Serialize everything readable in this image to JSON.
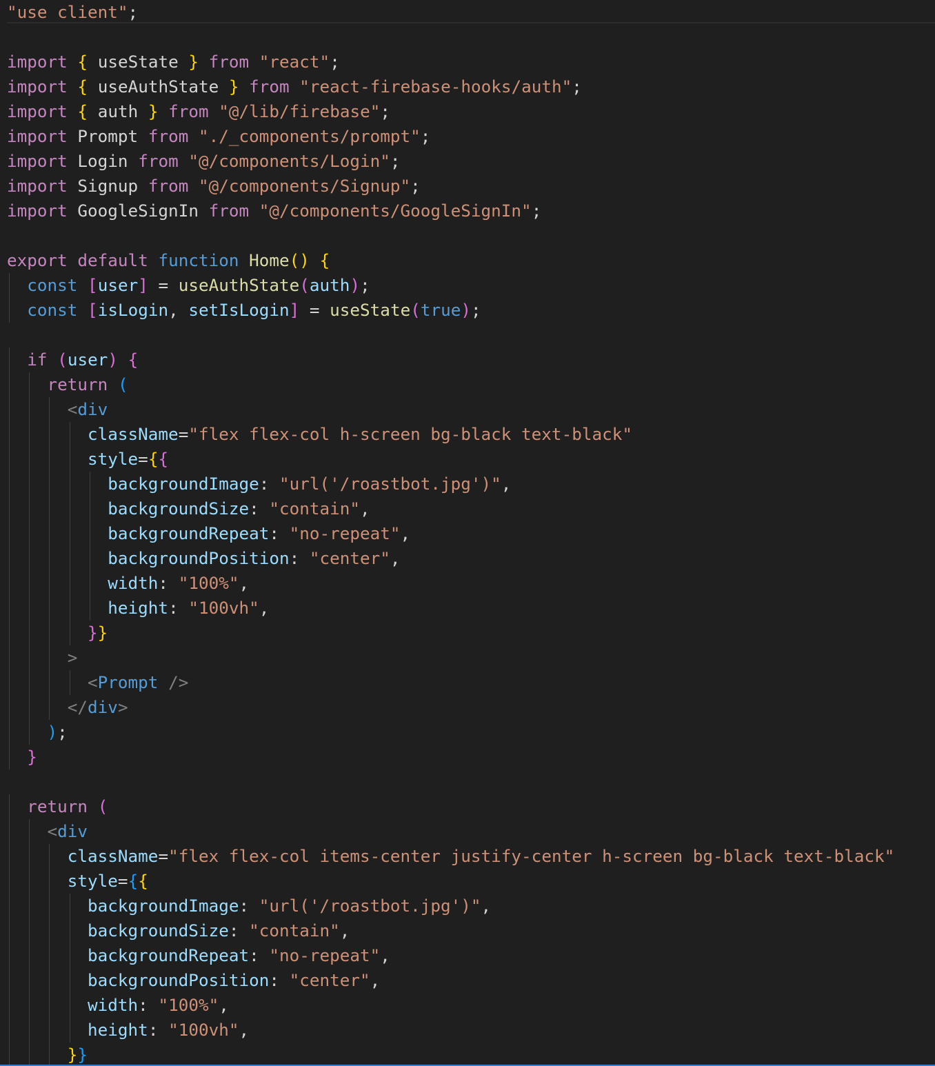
{
  "editor": {
    "language": "typescriptreact",
    "lines": [
      {
        "tokens": [
          [
            "\"use client\"",
            "string"
          ],
          [
            ";",
            "punct"
          ]
        ]
      },
      {
        "tokens": []
      },
      {
        "tokens": [
          [
            "import",
            "control"
          ],
          [
            " ",
            "plain"
          ],
          [
            "{",
            "bracket1"
          ],
          [
            " useState ",
            "plain"
          ],
          [
            "}",
            "bracket1"
          ],
          [
            " ",
            "plain"
          ],
          [
            "from",
            "control"
          ],
          [
            " ",
            "plain"
          ],
          [
            "\"react\"",
            "string"
          ],
          [
            ";",
            "punct"
          ]
        ]
      },
      {
        "tokens": [
          [
            "import",
            "control"
          ],
          [
            " ",
            "plain"
          ],
          [
            "{",
            "bracket1"
          ],
          [
            " useAuthState ",
            "plain"
          ],
          [
            "}",
            "bracket1"
          ],
          [
            " ",
            "plain"
          ],
          [
            "from",
            "control"
          ],
          [
            " ",
            "plain"
          ],
          [
            "\"react-firebase-hooks/auth\"",
            "string"
          ],
          [
            ";",
            "punct"
          ]
        ]
      },
      {
        "tokens": [
          [
            "import",
            "control"
          ],
          [
            " ",
            "plain"
          ],
          [
            "{",
            "bracket1"
          ],
          [
            " auth ",
            "plain"
          ],
          [
            "}",
            "bracket1"
          ],
          [
            " ",
            "plain"
          ],
          [
            "from",
            "control"
          ],
          [
            " ",
            "plain"
          ],
          [
            "\"@/lib/firebase\"",
            "string"
          ],
          [
            ";",
            "punct"
          ]
        ]
      },
      {
        "tokens": [
          [
            "import",
            "control"
          ],
          [
            " Prompt ",
            "plain"
          ],
          [
            "from",
            "control"
          ],
          [
            " ",
            "plain"
          ],
          [
            "\"./_components/prompt\"",
            "string"
          ],
          [
            ";",
            "punct"
          ]
        ]
      },
      {
        "tokens": [
          [
            "import",
            "control"
          ],
          [
            " Login ",
            "plain"
          ],
          [
            "from",
            "control"
          ],
          [
            " ",
            "plain"
          ],
          [
            "\"@/components/Login\"",
            "string"
          ],
          [
            ";",
            "punct"
          ]
        ]
      },
      {
        "tokens": [
          [
            "import",
            "control"
          ],
          [
            " Signup ",
            "plain"
          ],
          [
            "from",
            "control"
          ],
          [
            " ",
            "plain"
          ],
          [
            "\"@/components/Signup\"",
            "string"
          ],
          [
            ";",
            "punct"
          ]
        ]
      },
      {
        "tokens": [
          [
            "import",
            "control"
          ],
          [
            " GoogleSignIn ",
            "plain"
          ],
          [
            "from",
            "control"
          ],
          [
            " ",
            "plain"
          ],
          [
            "\"@/components/GoogleSignIn\"",
            "string"
          ],
          [
            ";",
            "punct"
          ]
        ]
      },
      {
        "tokens": []
      },
      {
        "tokens": [
          [
            "export",
            "control"
          ],
          [
            " ",
            "plain"
          ],
          [
            "default",
            "control"
          ],
          [
            " ",
            "plain"
          ],
          [
            "function",
            "keyword"
          ],
          [
            " ",
            "plain"
          ],
          [
            "Home",
            "func"
          ],
          [
            "()",
            "bracket1"
          ],
          [
            " ",
            "plain"
          ],
          [
            "{",
            "bracket1"
          ]
        ]
      },
      {
        "tokens": [
          [
            "  ",
            "plain"
          ],
          [
            "const",
            "keyword"
          ],
          [
            " ",
            "plain"
          ],
          [
            "[",
            "bracket2"
          ],
          [
            "user",
            "var"
          ],
          [
            "]",
            "bracket2"
          ],
          [
            " = ",
            "plain"
          ],
          [
            "useAuthState",
            "func"
          ],
          [
            "(",
            "bracket2"
          ],
          [
            "auth",
            "var"
          ],
          [
            ")",
            "bracket2"
          ],
          [
            ";",
            "punct"
          ]
        ]
      },
      {
        "tokens": [
          [
            "  ",
            "plain"
          ],
          [
            "const",
            "keyword"
          ],
          [
            " ",
            "plain"
          ],
          [
            "[",
            "bracket2"
          ],
          [
            "isLogin",
            "var"
          ],
          [
            ", ",
            "plain"
          ],
          [
            "setIsLogin",
            "var"
          ],
          [
            "]",
            "bracket2"
          ],
          [
            " = ",
            "plain"
          ],
          [
            "useState",
            "func"
          ],
          [
            "(",
            "bracket2"
          ],
          [
            "true",
            "keyword"
          ],
          [
            ")",
            "bracket2"
          ],
          [
            ";",
            "punct"
          ]
        ]
      },
      {
        "tokens": []
      },
      {
        "tokens": [
          [
            "  ",
            "plain"
          ],
          [
            "if",
            "control"
          ],
          [
            " ",
            "plain"
          ],
          [
            "(",
            "bracket2"
          ],
          [
            "user",
            "var"
          ],
          [
            ")",
            "bracket2"
          ],
          [
            " ",
            "plain"
          ],
          [
            "{",
            "bracket2"
          ]
        ]
      },
      {
        "tokens": [
          [
            "    ",
            "plain"
          ],
          [
            "return",
            "control"
          ],
          [
            " ",
            "plain"
          ],
          [
            "(",
            "bracket3"
          ]
        ]
      },
      {
        "tokens": [
          [
            "      ",
            "plain"
          ],
          [
            "<",
            "tagpunct"
          ],
          [
            "div",
            "tag"
          ]
        ]
      },
      {
        "tokens": [
          [
            "        ",
            "plain"
          ],
          [
            "className",
            "var"
          ],
          [
            "=",
            "punct"
          ],
          [
            "\"flex flex-col h-screen bg-black text-black\"",
            "string"
          ]
        ]
      },
      {
        "tokens": [
          [
            "        ",
            "plain"
          ],
          [
            "style",
            "var"
          ],
          [
            "=",
            "punct"
          ],
          [
            "{",
            "bracket1"
          ],
          [
            "{",
            "bracket2"
          ]
        ]
      },
      {
        "tokens": [
          [
            "          ",
            "plain"
          ],
          [
            "backgroundImage",
            "var"
          ],
          [
            ": ",
            "plain"
          ],
          [
            "\"url('/roastbot.jpg')\"",
            "string"
          ],
          [
            ",",
            "punct"
          ]
        ]
      },
      {
        "tokens": [
          [
            "          ",
            "plain"
          ],
          [
            "backgroundSize",
            "var"
          ],
          [
            ": ",
            "plain"
          ],
          [
            "\"contain\"",
            "string"
          ],
          [
            ",",
            "punct"
          ]
        ]
      },
      {
        "tokens": [
          [
            "          ",
            "plain"
          ],
          [
            "backgroundRepeat",
            "var"
          ],
          [
            ": ",
            "plain"
          ],
          [
            "\"no-repeat\"",
            "string"
          ],
          [
            ",",
            "punct"
          ]
        ]
      },
      {
        "tokens": [
          [
            "          ",
            "plain"
          ],
          [
            "backgroundPosition",
            "var"
          ],
          [
            ": ",
            "plain"
          ],
          [
            "\"center\"",
            "string"
          ],
          [
            ",",
            "punct"
          ]
        ]
      },
      {
        "tokens": [
          [
            "          ",
            "plain"
          ],
          [
            "width",
            "var"
          ],
          [
            ": ",
            "plain"
          ],
          [
            "\"100%\"",
            "string"
          ],
          [
            ",",
            "punct"
          ]
        ]
      },
      {
        "tokens": [
          [
            "          ",
            "plain"
          ],
          [
            "height",
            "var"
          ],
          [
            ": ",
            "plain"
          ],
          [
            "\"100vh\"",
            "string"
          ],
          [
            ",",
            "punct"
          ]
        ]
      },
      {
        "tokens": [
          [
            "        ",
            "plain"
          ],
          [
            "}",
            "bracket2"
          ],
          [
            "}",
            "bracket1"
          ]
        ]
      },
      {
        "tokens": [
          [
            "      ",
            "plain"
          ],
          [
            ">",
            "tagpunct"
          ]
        ]
      },
      {
        "tokens": [
          [
            "        ",
            "plain"
          ],
          [
            "<",
            "tagpunct"
          ],
          [
            "Prompt",
            "tag"
          ],
          [
            " ",
            "plain"
          ],
          [
            "/>",
            "tagpunct"
          ]
        ]
      },
      {
        "tokens": [
          [
            "      ",
            "plain"
          ],
          [
            "</",
            "tagpunct"
          ],
          [
            "div",
            "tag"
          ],
          [
            ">",
            "tagpunct"
          ]
        ]
      },
      {
        "tokens": [
          [
            "    ",
            "plain"
          ],
          [
            ")",
            "bracket3"
          ],
          [
            ";",
            "punct"
          ]
        ]
      },
      {
        "tokens": [
          [
            "  ",
            "plain"
          ],
          [
            "}",
            "bracket2"
          ]
        ]
      },
      {
        "tokens": []
      },
      {
        "tokens": [
          [
            "  ",
            "plain"
          ],
          [
            "return",
            "control"
          ],
          [
            " ",
            "plain"
          ],
          [
            "(",
            "bracket2"
          ]
        ]
      },
      {
        "tokens": [
          [
            "    ",
            "plain"
          ],
          [
            "<",
            "tagpunct"
          ],
          [
            "div",
            "tag"
          ]
        ]
      },
      {
        "tokens": [
          [
            "      ",
            "plain"
          ],
          [
            "className",
            "var"
          ],
          [
            "=",
            "punct"
          ],
          [
            "\"flex flex-col items-center justify-center h-screen bg-black text-black\"",
            "string"
          ]
        ]
      },
      {
        "tokens": [
          [
            "      ",
            "plain"
          ],
          [
            "style",
            "var"
          ],
          [
            "=",
            "punct"
          ],
          [
            "{",
            "bracket3"
          ],
          [
            "{",
            "bracket1"
          ]
        ]
      },
      {
        "tokens": [
          [
            "        ",
            "plain"
          ],
          [
            "backgroundImage",
            "var"
          ],
          [
            ": ",
            "plain"
          ],
          [
            "\"url('/roastbot.jpg')\"",
            "string"
          ],
          [
            ",",
            "punct"
          ]
        ]
      },
      {
        "tokens": [
          [
            "        ",
            "plain"
          ],
          [
            "backgroundSize",
            "var"
          ],
          [
            ": ",
            "plain"
          ],
          [
            "\"contain\"",
            "string"
          ],
          [
            ",",
            "punct"
          ]
        ]
      },
      {
        "tokens": [
          [
            "        ",
            "plain"
          ],
          [
            "backgroundRepeat",
            "var"
          ],
          [
            ": ",
            "plain"
          ],
          [
            "\"no-repeat\"",
            "string"
          ],
          [
            ",",
            "punct"
          ]
        ]
      },
      {
        "tokens": [
          [
            "        ",
            "plain"
          ],
          [
            "backgroundPosition",
            "var"
          ],
          [
            ": ",
            "plain"
          ],
          [
            "\"center\"",
            "string"
          ],
          [
            ",",
            "punct"
          ]
        ]
      },
      {
        "tokens": [
          [
            "        ",
            "plain"
          ],
          [
            "width",
            "var"
          ],
          [
            ": ",
            "plain"
          ],
          [
            "\"100%\"",
            "string"
          ],
          [
            ",",
            "punct"
          ]
        ]
      },
      {
        "tokens": [
          [
            "        ",
            "plain"
          ],
          [
            "height",
            "var"
          ],
          [
            ": ",
            "plain"
          ],
          [
            "\"100vh\"",
            "string"
          ],
          [
            ",",
            "punct"
          ]
        ]
      },
      {
        "tokens": [
          [
            "      ",
            "plain"
          ],
          [
            "}",
            "bracket1"
          ],
          [
            "}",
            "bracket3"
          ]
        ]
      }
    ],
    "colors": {
      "background": "#1f1f1f",
      "keyword": "#569cd6",
      "control": "#c586c0",
      "string": "#ce9178",
      "variable": "#9cdcfe",
      "function": "#dcdcaa",
      "plain": "#d4d4d4",
      "bracket_gold": "#ffd700",
      "bracket_orchid": "#da70d6",
      "bracket_blue": "#179fff"
    }
  }
}
